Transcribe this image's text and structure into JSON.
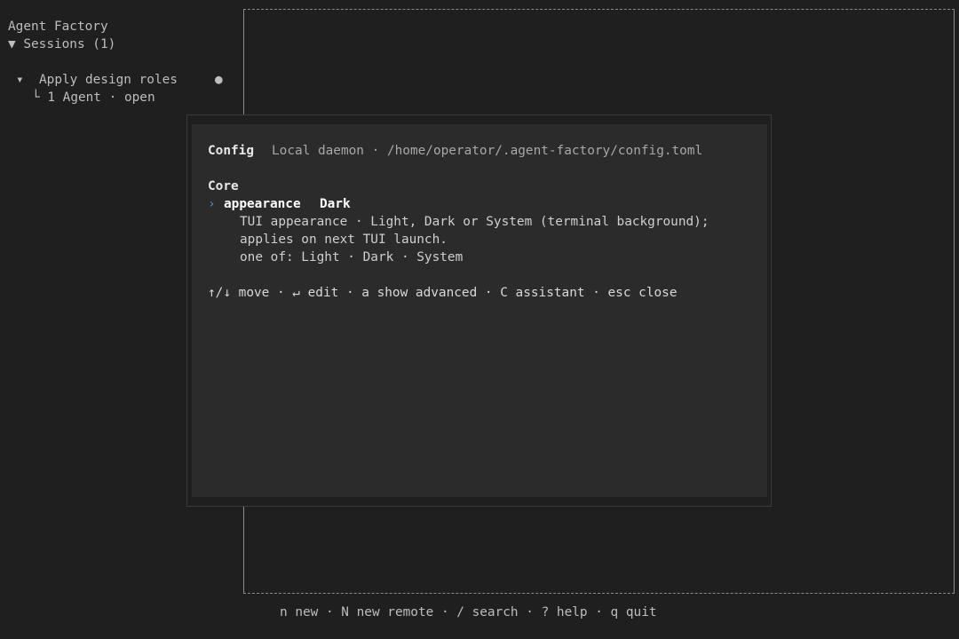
{
  "sidebar": {
    "app_title": "Agent Factory",
    "sessions_header": "▼ Sessions (1)",
    "sessions": [
      {
        "label": "▾  Apply design roles",
        "status_dot": "●",
        "sub": "└ 1 Agent · open"
      }
    ]
  },
  "config_modal": {
    "title": "Config",
    "source": "Local daemon · /home/operator/.agent-factory/config.toml",
    "section": "Core",
    "cursor": "›",
    "setting": {
      "name": "appearance",
      "value": "Dark",
      "description_line1": "TUI appearance · Light, Dark or System (terminal background);",
      "description_line2": "applies on next TUI launch.",
      "options_line": "one of: Light · Dark · System"
    },
    "hints": "↑/↓ move · ↵ edit · a show advanced · C assistant · esc close"
  },
  "footer": {
    "hints": "n new · N new remote · / search · ? help · q quit"
  },
  "colors": {
    "background": "#1f1f1f",
    "modal_background": "#2b2b2b",
    "cursor_accent": "#4a90d9",
    "text": "#c9c9c9",
    "border": "#8a8a8a"
  }
}
